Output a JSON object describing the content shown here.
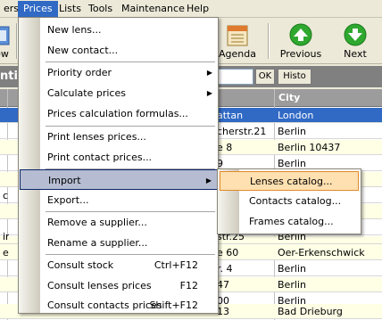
{
  "menubar": {
    "items": [
      "ers",
      "Prices",
      "Lists",
      "Tools",
      "Maintenance",
      "Help"
    ]
  },
  "toolbar": {
    "left_label": "ew",
    "agenda_label": "Agenda",
    "previous_label": "Previous",
    "next_label": "Next"
  },
  "search": {
    "heading_fragment": "ntie",
    "ok_label": "OK",
    "histo_label": "Histo"
  },
  "grid": {
    "city_header": "City",
    "rows": [
      {
        "left": "",
        "address": "attan",
        "city": "London"
      },
      {
        "left": "",
        "address": "cherstr.21",
        "city": "Berlin"
      },
      {
        "left": "",
        "address": "e 8",
        "city": "Berlin 10437"
      },
      {
        "left": "",
        "address": "9",
        "city": "Berlin"
      },
      {
        "left": "",
        "address": "",
        "city": ""
      },
      {
        "left": "ch",
        "address": "",
        "city": ""
      },
      {
        "left": "",
        "address": "",
        "city": ""
      },
      {
        "left": "",
        "address": "",
        "city": ""
      },
      {
        "left": "",
        "address": "",
        "city": ""
      },
      {
        "left": "in",
        "address": "str.25",
        "city": "Berlin"
      },
      {
        "left": "er",
        "address": "e 60",
        "city": "Oer-Erkenschwick"
      },
      {
        "left": "",
        "address": "r. 4",
        "city": "Berlin"
      },
      {
        "left": "",
        "address": "47",
        "city": "Berlin"
      },
      {
        "left": "",
        "address": "00",
        "city": "Berlin"
      },
      {
        "left": "",
        "address": "13",
        "city": "Bad Drieburg"
      }
    ]
  },
  "menu": {
    "items": {
      "new_lens": "New lens...",
      "new_contact": "New contact...",
      "priority_order": "Priority order",
      "calculate_prices": "Calculate prices",
      "formulas": "Prices calculation formulas...",
      "print_lenses": "Print lenses prices...",
      "print_contact": "Print contact prices...",
      "import": "Import",
      "export": "Export...",
      "remove_supplier": "Remove a supplier...",
      "rename_supplier": "Rename a supplier...",
      "consult_stock": "Consult stock",
      "consult_stock_shortcut": "Ctrl+F12",
      "consult_lenses": "Consult lenses prices",
      "consult_lenses_shortcut": "F12",
      "consult_contacts": "Consult contacts prices",
      "consult_contacts_shortcut": "Shift+F12"
    }
  },
  "submenu": {
    "lenses_catalog": "Lenses catalog...",
    "contacts_catalog": "Contacts catalog...",
    "frames_catalog": "Frames catalog..."
  },
  "colors": {
    "selection": "#316ac5",
    "menu_highlight": "#b6bdd2",
    "submenu_highlight": "#ffe0b0",
    "toolbar_green": "#2ea82e"
  }
}
